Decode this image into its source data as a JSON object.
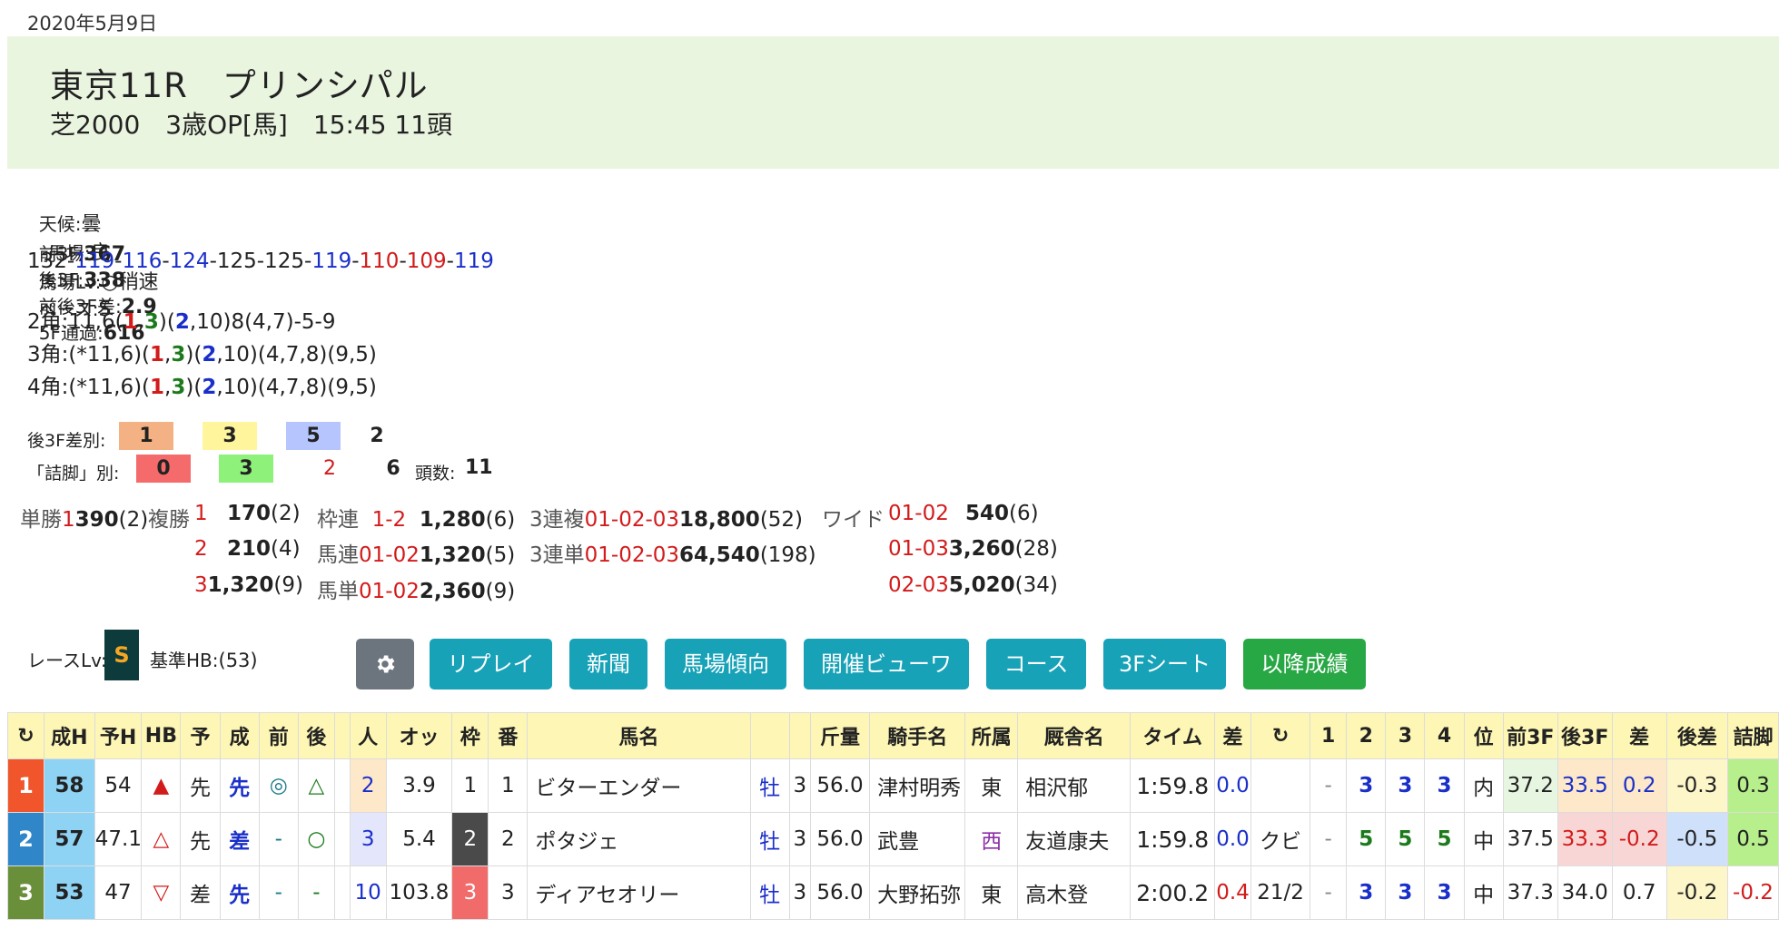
{
  "date": "2020年5月9日",
  "race": {
    "title": "東京11R　プリンシパル",
    "subtitle": "芝2000　3歳OP[馬]　15:45 11頭"
  },
  "conditions": {
    "weather_label": "天候:",
    "weather": "曇",
    "track_label": "馬場:",
    "track": "良",
    "track_lv_label": "馬場Lv:",
    "track_lv": "○稍速",
    "pace_label": "ペース:",
    "pace": "S"
  },
  "splits": {
    "f3_label": "前3F:",
    "f3": "367",
    "l3_label": "後3F:",
    "l3": "338",
    "diff_label": "前後3F差:",
    "diff": "2.9",
    "f5_label": "5F通過:",
    "f5": "616"
  },
  "laps": [
    {
      "v": "132",
      "c": "nrm"
    },
    {
      "v": "119",
      "c": "blue"
    },
    {
      "v": "116",
      "c": "blue"
    },
    {
      "v": "124",
      "c": "blue"
    },
    {
      "v": "125",
      "c": "nrm"
    },
    {
      "v": "125",
      "c": "nrm"
    },
    {
      "v": "119",
      "c": "blue"
    },
    {
      "v": "110",
      "c": "red"
    },
    {
      "v": "109",
      "c": "red"
    },
    {
      "v": "119",
      "c": "blue"
    }
  ],
  "corners": {
    "c2": {
      "label": "2角:",
      "pre": "11,6(",
      "a": "1",
      "b": "3",
      "mid": ")(",
      "c": "2",
      "post": ",10)8(4,7)-5-9"
    },
    "c3": {
      "label": "3角:",
      "pre": "(*11,6)(",
      "a": "1",
      "b": "3",
      "mid": ")(",
      "c": "2",
      "post": ",10)(4,7,8)(9,5)"
    },
    "c4": {
      "label": "4角:",
      "pre": "(*11,6)(",
      "a": "1",
      "b": "3",
      "mid": ")(",
      "c": "2",
      "post": ",10)(4,7,8)(9,5)"
    }
  },
  "last3f_rank": {
    "label": "後3F差別:",
    "values": [
      "1",
      "3",
      "5",
      "2"
    ],
    "colors": [
      "#f4b183",
      "#fff59d",
      "#b7c5ff",
      "#ffffff"
    ]
  },
  "tsume": {
    "label": "「詰脚」別:",
    "values": [
      "0",
      "3",
      "2",
      "6"
    ],
    "colors": [
      "#f56b6b",
      "#8ef27a",
      "#ffffff",
      "#ffffff"
    ],
    "head_label": "頭数:",
    "head": "11"
  },
  "payouts": {
    "tansho_label": "単勝",
    "tansho_num": "1",
    "tansho_val": "390",
    "tansho_pop": "(2)",
    "fukusho_label": "複勝",
    "fukusho": [
      {
        "num": "1",
        "val": "170",
        "pop": "(2)"
      },
      {
        "num": "2",
        "val": "210",
        "pop": "(4)"
      },
      {
        "num": "3",
        "val": "1,320",
        "pop": "(9)"
      }
    ],
    "wakuren_label": "枠連",
    "wakuren_num": "1-2",
    "wakuren_val": "1,280",
    "wakuren_pop": "(6)",
    "umaren_label": "馬連",
    "umaren_num": "01-02",
    "umaren_val": "1,320",
    "umaren_pop": "(5)",
    "umatan_label": "馬単",
    "umatan_num": "01-02",
    "umatan_val": "2,360",
    "umatan_pop": "(9)",
    "sanrenpuku_label": "3連複",
    "sanrenpuku_num": "01-02-03",
    "sanrenpuku_val": "18,800",
    "sanrenpuku_pop": "(52)",
    "sanrentan_label": "3連単",
    "sanrentan_num": "01-02-03",
    "sanrentan_val": "64,540",
    "sanrentan_pop": "(198)",
    "wide_label": "ワイド",
    "wide": [
      {
        "num": "01-02",
        "val": "540",
        "pop": "(6)"
      },
      {
        "num": "01-03",
        "val": "3,260",
        "pop": "(28)"
      },
      {
        "num": "02-03",
        "val": "5,020",
        "pop": "(34)"
      }
    ]
  },
  "race_level": {
    "label": "レースLv:",
    "value": "S",
    "base_label": "基準HB:",
    "base": "(53)"
  },
  "buttons": [
    "リプレイ",
    "新聞",
    "馬場傾向",
    "開催ビューワ",
    "コース",
    "3Fシート",
    "以降成績"
  ],
  "table": {
    "headers": [
      "",
      "成H",
      "予H",
      "HB",
      "予",
      "成",
      "前",
      "後",
      "",
      "人",
      "オッ",
      "枠",
      "番",
      "馬名",
      "",
      "",
      "斤量",
      "騎手名",
      "所属",
      "厩舎名",
      "タイム",
      "差",
      "",
      "1",
      "2",
      "3",
      "4",
      "位",
      "前3F",
      "後3F",
      "差",
      "後差",
      "詰脚"
    ],
    "rows": [
      {
        "rank": "1",
        "rank_color": "#f0552c",
        "sei_h": "58",
        "yo_h": "54",
        "hb": "▲",
        "yo": "先",
        "sei": "先",
        "mae": "◎",
        "ato": "△",
        "blank": "",
        "pop": "2",
        "pop_bg": "#fde8c9",
        "odds": "3.9",
        "waku": "1",
        "waku_bg": "#ffffff",
        "waku_fg": "#222222",
        "ban": "1",
        "name": "ビターエンダー",
        "sex": "牡",
        "age": "3",
        "kinryo": "56.0",
        "jockey": "津村明秀",
        "belong": "東",
        "trainer": "相沢郁",
        "time": "1:59.8",
        "diff": "0.0",
        "margin": "",
        "c1": "-",
        "c2": "3",
        "c3": "3",
        "c4": "3",
        "pos": "内",
        "f3": "37.2",
        "f3_bg": "#e7f6e0",
        "l3": "33.5",
        "l3_bg": "#fde8c9",
        "d": "0.2",
        "d_bg": "#fde8c9",
        "ld": "-0.3",
        "ld_bg": "#fdf6c9",
        "tsume": "0.3",
        "tsume_bg": "#b6ef8b"
      },
      {
        "rank": "2",
        "rank_color": "#2f86c9",
        "sei_h": "57",
        "yo_h": "47.1",
        "hb": "△",
        "yo": "先",
        "sei": "差",
        "mae": "-",
        "ato": "○",
        "blank": "",
        "pop": "3",
        "pop_bg": "#e4e6fb",
        "odds": "5.4",
        "waku": "2",
        "waku_bg": "#4a4a4a",
        "waku_fg": "#ffffff",
        "ban": "2",
        "name": "ポタジェ",
        "sex": "牡",
        "age": "3",
        "kinryo": "56.0",
        "jockey": "武豊",
        "belong": "西",
        "trainer": "友道康夫",
        "time": "1:59.8",
        "diff": "0.0",
        "margin": "クビ",
        "c1": "-",
        "c2": "5",
        "c3": "5",
        "c4": "5",
        "pos": "中",
        "f3": "37.5",
        "f3_bg": "#ffffff",
        "l3": "33.3",
        "l3_bg": "#f9d6d6",
        "d": "-0.2",
        "d_bg": "#f9d6d6",
        "ld": "-0.5",
        "ld_bg": "#cfe0fb",
        "tsume": "0.5",
        "tsume_bg": "#b6ef8b"
      },
      {
        "rank": "3",
        "rank_color": "#6a8f3a",
        "sei_h": "53",
        "yo_h": "47",
        "hb": "▽",
        "yo": "差",
        "sei": "先",
        "mae": "-",
        "ato": "-",
        "blank": "",
        "pop": "10",
        "pop_bg": "#ffffff",
        "odds": "103.8",
        "waku": "3",
        "waku_bg": "#f26b6b",
        "waku_fg": "#ffffff",
        "ban": "3",
        "name": "ディアセオリー",
        "sex": "牡",
        "age": "3",
        "kinryo": "56.0",
        "jockey": "大野拓弥",
        "belong": "東",
        "trainer": "高木登",
        "time": "2:00.2",
        "diff": "0.4",
        "margin": "21/2",
        "c1": "-",
        "c2": "3",
        "c3": "3",
        "c4": "3",
        "pos": "中",
        "f3": "37.3",
        "f3_bg": "#ffffff",
        "l3": "34.0",
        "l3_bg": "#ffffff",
        "d": "0.7",
        "d_bg": "#ffffff",
        "ld": "-0.2",
        "ld_bg": "#fdf6c9",
        "tsume": "-0.2",
        "tsume_bg": "#ffffff"
      }
    ]
  },
  "colors": {
    "header_bg": "#eaf5e0",
    "button": "#17a2b8",
    "button_gear": "#6c757d",
    "button_green": "#28a745",
    "table_head": "#fdf6b5"
  }
}
